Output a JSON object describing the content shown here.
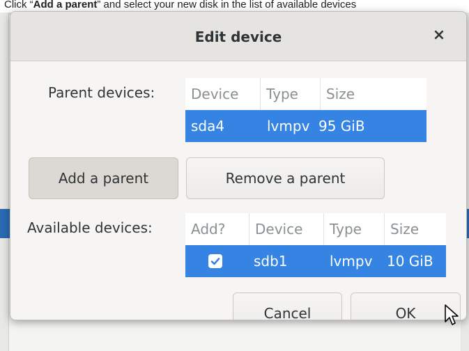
{
  "instruction": {
    "prefix": "Click “",
    "bold": "Add a parent",
    "suffix": "” and select your new disk in the list of available devices"
  },
  "dialog": {
    "title": "Edit device",
    "close_glyph": "×",
    "parent_devices": {
      "label": "Parent devices:",
      "columns": [
        "Device",
        "Type",
        "Size"
      ],
      "rows": [
        {
          "device": "sda4",
          "type": "lvmpv",
          "size": "95 GiB",
          "selected": true
        }
      ]
    },
    "add_parent_label": "Add a parent",
    "remove_parent_label": "Remove a parent",
    "available_devices": {
      "label": "Available devices:",
      "columns": [
        "Add?",
        "Device",
        "Type",
        "Size"
      ],
      "rows": [
        {
          "add": true,
          "device": "sdb1",
          "type": "lvmpv",
          "size": "10 GiB",
          "selected": true
        }
      ]
    },
    "cancel_label": "Cancel",
    "ok_label": "OK"
  },
  "icons": {
    "close": "close-icon",
    "check": "check-icon",
    "cursor": "mouse-pointer-icon"
  },
  "colors": {
    "selection": "#3584e4",
    "header_text": "#8a8f92",
    "text": "#2e3436"
  }
}
